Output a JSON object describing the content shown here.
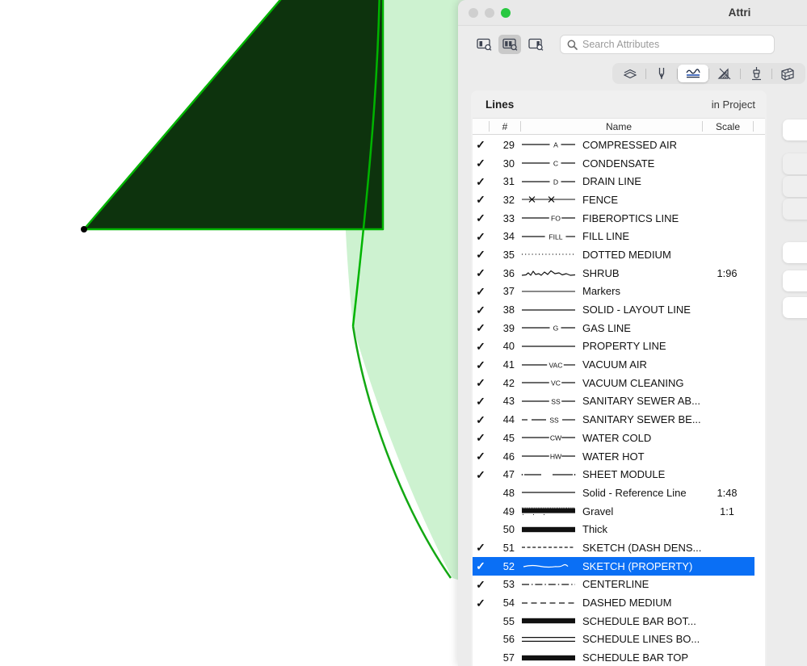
{
  "window": {
    "title": "Attri",
    "traffic_lights": [
      "close",
      "minimize",
      "zoom"
    ]
  },
  "toolbar": {
    "view_modes": [
      {
        "name": "sidebar-only-view",
        "selected": false
      },
      {
        "name": "split-view",
        "selected": true
      },
      {
        "name": "detail-only-view",
        "selected": false
      }
    ],
    "search": {
      "placeholder": "Search Attributes",
      "value": ""
    }
  },
  "attribute_types": [
    {
      "name": "layers-icon",
      "label": "Layers",
      "selected": false
    },
    {
      "name": "pen-icon",
      "label": "Pen",
      "selected": false
    },
    {
      "name": "lines-icon",
      "label": "Lines",
      "selected": true
    },
    {
      "name": "hatch-icon",
      "label": "Hatch",
      "selected": false
    },
    {
      "name": "brush-icon",
      "label": "Brush",
      "selected": false
    },
    {
      "name": "wall-icon",
      "label": "Wall",
      "selected": false
    }
  ],
  "panel": {
    "title": "Lines",
    "scope": "in Project"
  },
  "columns": {
    "check": "",
    "number": "#",
    "name": "Name",
    "scale": "Scale"
  },
  "rows": [
    {
      "checked": true,
      "num": "29",
      "style": "solid-label-A",
      "label": "A",
      "name": "COMPRESSED AIR",
      "scale": ""
    },
    {
      "checked": true,
      "num": "30",
      "style": "solid-label-C",
      "label": "C",
      "name": "CONDENSATE",
      "scale": ""
    },
    {
      "checked": true,
      "num": "31",
      "style": "solid-label-D",
      "label": "D",
      "name": "DRAIN LINE",
      "scale": ""
    },
    {
      "checked": true,
      "num": "32",
      "style": "fence-x",
      "label": "",
      "name": "FENCE",
      "scale": ""
    },
    {
      "checked": true,
      "num": "33",
      "style": "solid-label-FO",
      "label": "FO",
      "name": "FIBEROPTICS LINE",
      "scale": ""
    },
    {
      "checked": true,
      "num": "34",
      "style": "solid-label-FILL",
      "label": "FILL",
      "name": "FILL LINE",
      "scale": ""
    },
    {
      "checked": true,
      "num": "35",
      "style": "dotted",
      "label": "",
      "name": "DOTTED MEDIUM",
      "scale": ""
    },
    {
      "checked": true,
      "num": "36",
      "style": "shrub",
      "label": "",
      "name": "SHRUB",
      "scale": "1:96"
    },
    {
      "checked": true,
      "num": "37",
      "style": "thin-solid",
      "label": "",
      "name": "Markers",
      "scale": ""
    },
    {
      "checked": true,
      "num": "38",
      "style": "solid",
      "label": "",
      "name": "SOLID - LAYOUT LINE",
      "scale": ""
    },
    {
      "checked": true,
      "num": "39",
      "style": "solid-label-G",
      "label": "G",
      "name": "GAS LINE",
      "scale": ""
    },
    {
      "checked": true,
      "num": "40",
      "style": "solid",
      "label": "",
      "name": "PROPERTY LINE",
      "scale": ""
    },
    {
      "checked": true,
      "num": "41",
      "style": "solid-label-VAC",
      "label": "VAC",
      "name": "VACUUM AIR",
      "scale": ""
    },
    {
      "checked": true,
      "num": "42",
      "style": "solid-label-VC",
      "label": "VC",
      "name": "VACUUM CLEANING",
      "scale": ""
    },
    {
      "checked": true,
      "num": "43",
      "style": "solid-label-SS",
      "label": "SS",
      "name": "SANITARY SEWER AB...",
      "scale": ""
    },
    {
      "checked": true,
      "num": "44",
      "style": "dash-label-SS",
      "label": "SS",
      "name": "SANITARY SEWER BE...",
      "scale": ""
    },
    {
      "checked": true,
      "num": "45",
      "style": "solid-label-CW",
      "label": "CW",
      "name": "WATER COLD",
      "scale": ""
    },
    {
      "checked": true,
      "num": "46",
      "style": "solid-label-HW",
      "label": "HW",
      "name": "WATER HOT",
      "scale": ""
    },
    {
      "checked": true,
      "num": "47",
      "style": "sheet-module",
      "label": "",
      "name": "SHEET MODULE",
      "scale": ""
    },
    {
      "checked": false,
      "num": "48",
      "style": "solid",
      "label": "",
      "name": "Solid - Reference Line",
      "scale": "1:48"
    },
    {
      "checked": false,
      "num": "49",
      "style": "gravel",
      "label": "",
      "name": "Gravel",
      "scale": "1:1"
    },
    {
      "checked": false,
      "num": "50",
      "style": "thick",
      "label": "",
      "name": "Thick",
      "scale": ""
    },
    {
      "checked": true,
      "num": "51",
      "style": "dashed-dense",
      "label": "",
      "name": "SKETCH (DASH DENS...",
      "scale": ""
    },
    {
      "checked": true,
      "num": "52",
      "style": "sketch-wavy",
      "label": "",
      "name": "SKETCH (PROPERTY)",
      "scale": "",
      "selected": true
    },
    {
      "checked": true,
      "num": "53",
      "style": "centerline",
      "label": "",
      "name": "CENTERLINE",
      "scale": ""
    },
    {
      "checked": true,
      "num": "54",
      "style": "dashed-medium",
      "label": "",
      "name": "DASHED MEDIUM",
      "scale": ""
    },
    {
      "checked": false,
      "num": "55",
      "style": "thick",
      "label": "",
      "name": "SCHEDULE BAR BOT...",
      "scale": ""
    },
    {
      "checked": false,
      "num": "56",
      "style": "double-line",
      "label": "",
      "name": "SCHEDULE LINES BO...",
      "scale": ""
    },
    {
      "checked": false,
      "num": "57",
      "style": "thick",
      "label": "",
      "name": "SCHEDULE BAR TOP",
      "scale": ""
    }
  ],
  "side_cards": [
    {
      "name": "card-1",
      "dim": false
    },
    {
      "name": "card-2",
      "dim": true
    },
    {
      "name": "card-3",
      "dim": true
    },
    {
      "name": "card-4",
      "dim": true
    },
    {
      "name": "card-5",
      "dim": false
    },
    {
      "name": "card-6",
      "dim": false
    },
    {
      "name": "card-7",
      "dim": false
    }
  ],
  "canvas": {
    "shape_fill": "#0d330d",
    "shape_outline": "#00b400",
    "highlight_fill": "#cdf2d0",
    "vertex_color": "#000000"
  },
  "top_bars": [
    {
      "name": "top-bar-1"
    },
    {
      "name": "top-bar-2"
    },
    {
      "name": "top-bar-3"
    }
  ]
}
